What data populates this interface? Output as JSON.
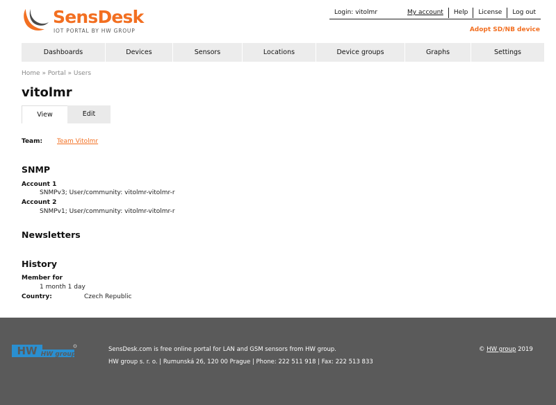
{
  "brand": {
    "name": "SensDesk",
    "tagline": "IOT PORTAL BY HW GROUP"
  },
  "top_links": {
    "login": "Login: vitolmr",
    "my_account": "My account",
    "help": "Help",
    "license": "License",
    "logout": "Log out"
  },
  "adopt_label": "Adopt SD/NB device",
  "nav": [
    {
      "label": "Dashboards"
    },
    {
      "label": "Devices"
    },
    {
      "label": "Sensors"
    },
    {
      "label": "Locations"
    },
    {
      "label": "Device groups"
    },
    {
      "label": "Graphs"
    },
    {
      "label": "Settings"
    }
  ],
  "breadcrumb": "Home » Portal » Users",
  "page_title": "vitolmr",
  "tabs": [
    {
      "label": "View",
      "active": true
    },
    {
      "label": "Edit",
      "active": false
    }
  ],
  "team": {
    "label": "Team:",
    "value": "Team Vitolmr"
  },
  "snmp": {
    "heading": "SNMP",
    "accounts": [
      {
        "label": "Account 1",
        "value": "SNMPv3; User/community: vitolmr-vitolmr-r"
      },
      {
        "label": "Account 2",
        "value": "SNMPv1; User/community: vitolmr-vitolmr-r"
      }
    ]
  },
  "newsletters": {
    "heading": "Newsletters"
  },
  "history": {
    "heading": "History",
    "member_label": "Member for",
    "member_value": "1 month 1 day",
    "country_label": "Country:",
    "country_value": "Czech Republic"
  },
  "footer": {
    "logo_text": "HW group",
    "line1": "SensDesk.com is free online portal for LAN and GSM sensors from HW group.",
    "line2": "HW group s. r. o. | Rumunská 26, 120 00 Prague | Phone: 222 511 918 | Fax: 222 513 833",
    "copy_symbol": "©",
    "copy_link": "HW group",
    "copy_year": "2019"
  },
  "colors": {
    "accent": "#f26f21",
    "nav_bg": "#ececec",
    "footer_bg": "#5a5a5a",
    "hw_blue": "#2a8fd0"
  }
}
